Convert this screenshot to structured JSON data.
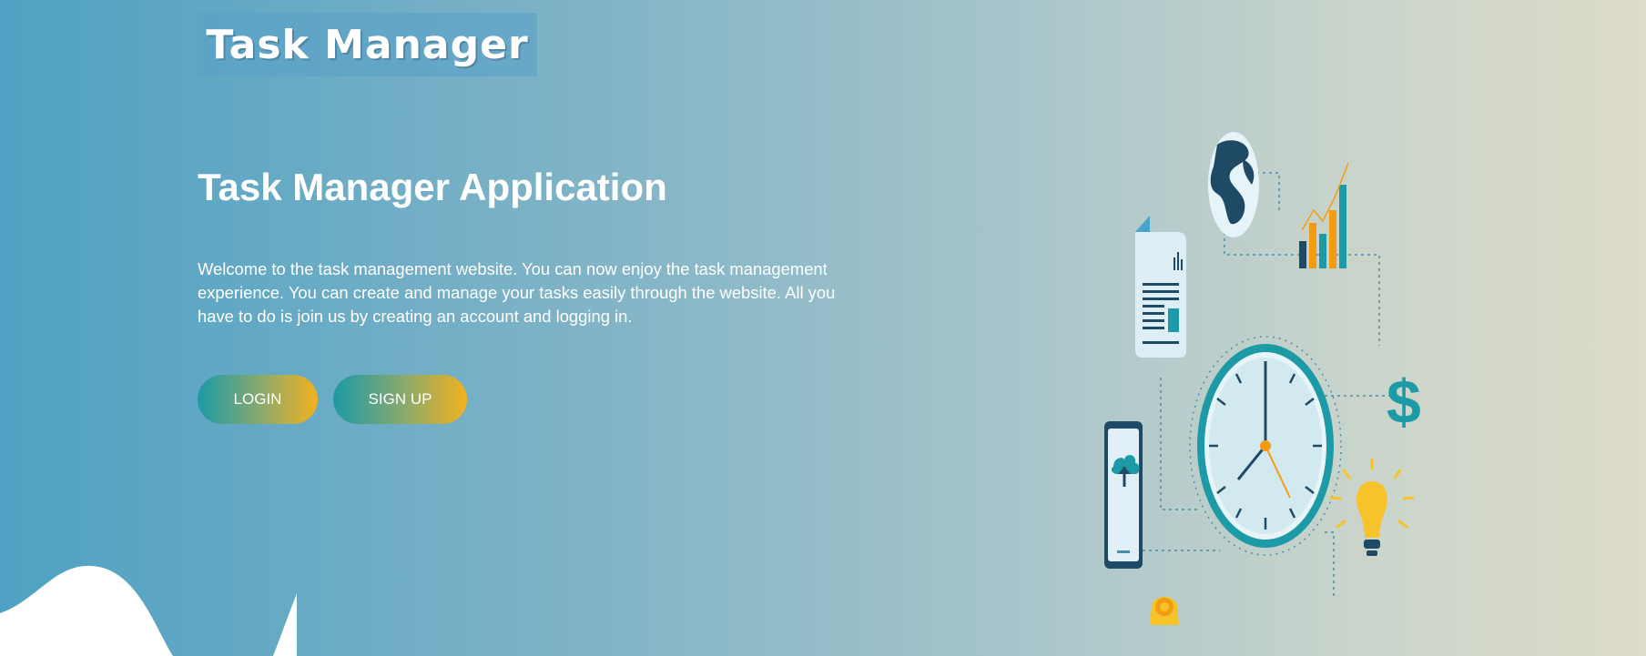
{
  "header": {
    "logo_text": "Task Manager"
  },
  "hero": {
    "title": "Task Manager Application",
    "description": "Welcome to the task management website. You can now enjoy the task management experience. You can create and manage your tasks easily through the website. All you have to do is join us by creating an account and logging in.",
    "login_label": "LOGIN",
    "signup_label": "SIGN UP"
  },
  "illustration": {
    "dollar_sign": "$",
    "icons": [
      "globe-icon",
      "bar-chart-icon",
      "document-icon",
      "clock-icon",
      "smartphone-cloud-icon",
      "dollar-icon",
      "lightbulb-icon",
      "gear-icon"
    ]
  },
  "colors": {
    "teal": "#1c9aa6",
    "orange": "#f1b21e",
    "navy": "#1e4a66"
  }
}
